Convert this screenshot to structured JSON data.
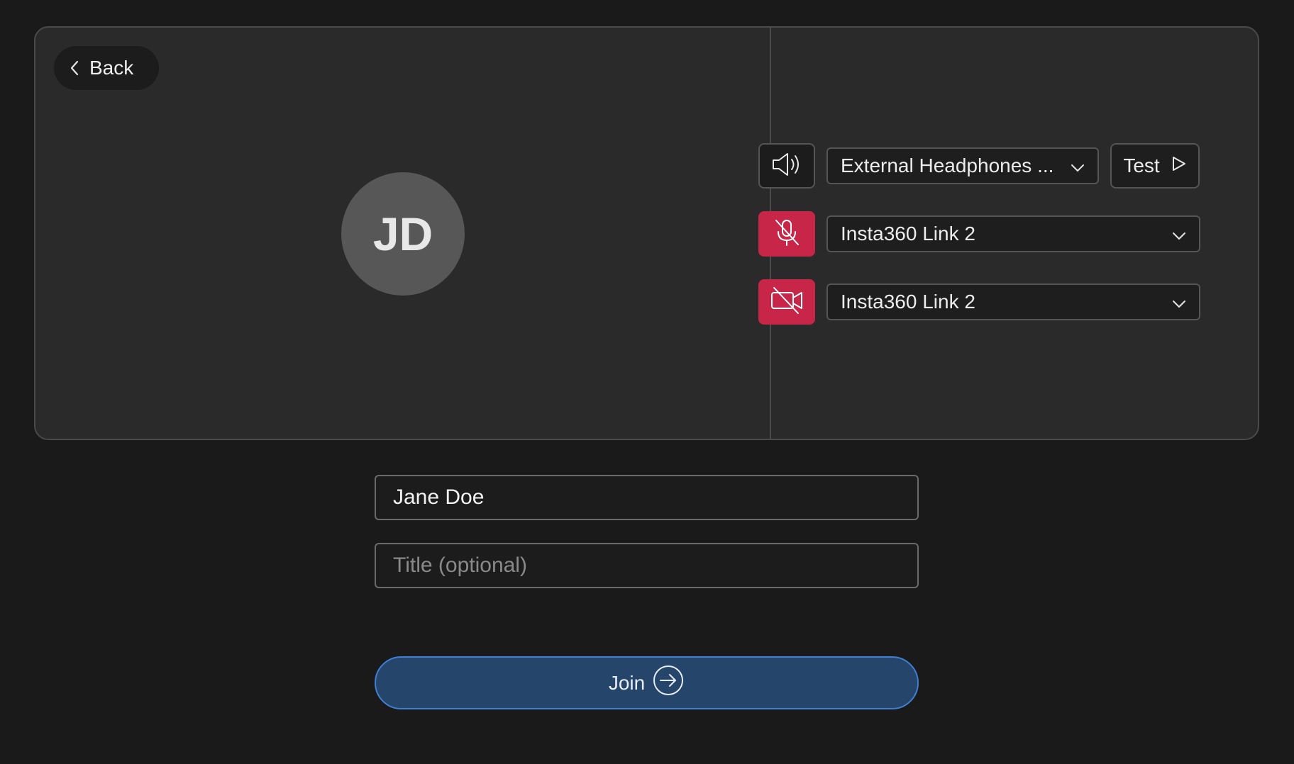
{
  "back": {
    "label": "Back",
    "icon": "chevron-left-icon"
  },
  "preview": {
    "initials": "JD"
  },
  "devices": {
    "speaker": {
      "icon": "speaker-icon",
      "selected": "External Headphones ...",
      "test_label": "Test"
    },
    "microphone": {
      "icon": "mic-off-icon",
      "selected": "Insta360 Link 2",
      "muted": true
    },
    "camera": {
      "icon": "camera-off-icon",
      "selected": "Insta360 Link 2",
      "off": true
    }
  },
  "form": {
    "name_value": "Jane Doe",
    "title_placeholder": "Title (optional)",
    "title_value": ""
  },
  "join": {
    "label": "Join",
    "icon": "arrow-right-circle-icon"
  },
  "colors": {
    "background": "#1a1a1a",
    "panel": "#2a2a2a",
    "danger": "#c72648",
    "join_fill": "#25456b",
    "join_border": "#3f7fd4"
  }
}
